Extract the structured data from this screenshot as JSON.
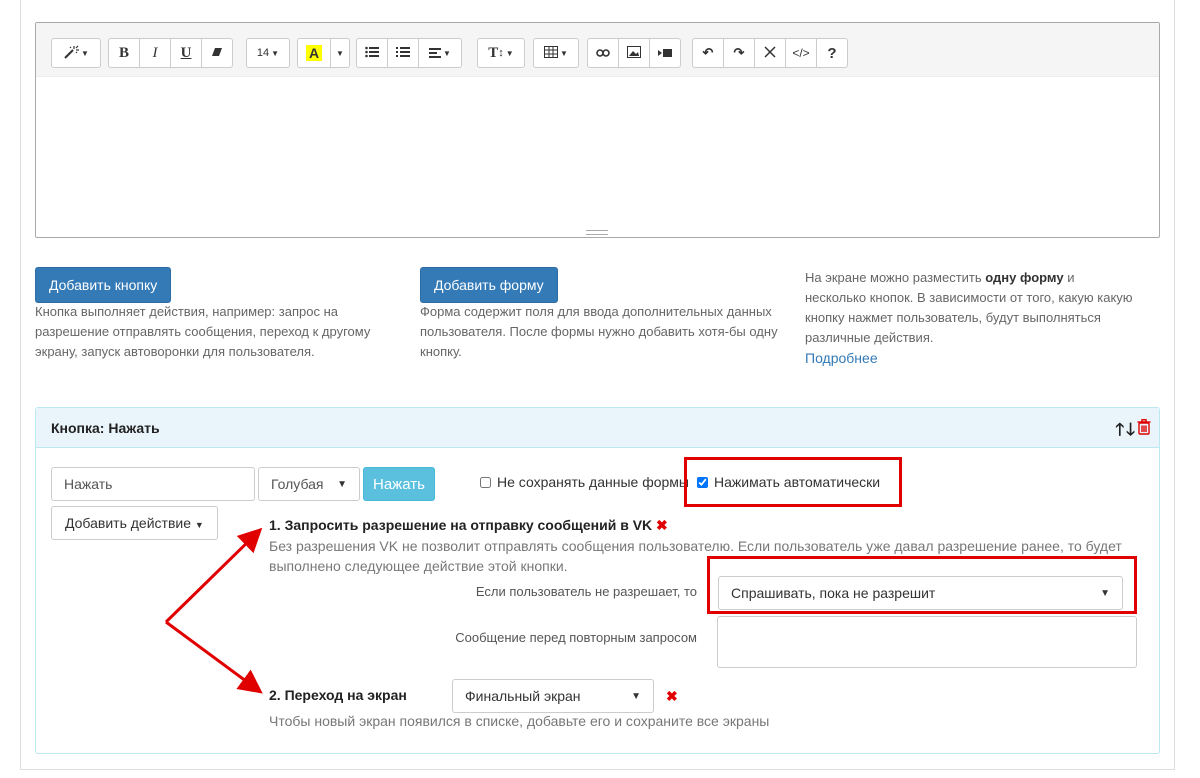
{
  "toolbar": {
    "style_icon": "magic-wand-icon",
    "bold": "B",
    "italic": "I",
    "underline": "U",
    "font_size": "14",
    "font_color": "A",
    "font_color_hex": "#ffff00",
    "help": "?",
    "code": "</>",
    "text_style": "T"
  },
  "actions": {
    "add_button_label": "Добавить кнопку",
    "add_button_desc": "Кнопка выполняет действия, например: запрос на разрешение отправлять сообщения, переход к другому экрану, запуск автоворонки для пользователя.",
    "add_form_label": "Добавить форму",
    "add_form_desc": "Форма содержит поля для ввода дополнительных данных пользователя. После формы нужно добавить хотя-бы одну кнопку.",
    "info_part1": "На экране можно разместить ",
    "info_bold": "одну форму",
    "info_part2": " и несколько кнопок. В зависимости от того, какую какую кнопку нажмет пользователь, будут выполняться различные действия.",
    "info_link": "Подробнее"
  },
  "panel": {
    "title": "Кнопка: Нажать",
    "button_text_value": "Нажать",
    "color_select": "Голубая",
    "preview_button": "Нажать",
    "no_save_label": "Не сохранять данные формы",
    "no_save_checked": false,
    "auto_press_label": "Нажимать автоматически",
    "auto_press_checked": true,
    "add_action_label": "Добавить действие",
    "step1_title": "1. Запросить разрешение на отправку сообщений в VK",
    "step1_desc": "Без разрешения VK не позволит отправлять сообщения пользователю. Если пользователь уже давал разрешение ранее, то будет выполнено следующее действие этой кнопки.",
    "if_denied_label": "Если пользователь не разрешает, то",
    "if_denied_value": "Спрашивать, пока не разрешит",
    "retry_message_label": "Сообщение перед повторным запросом",
    "retry_message_value": "",
    "step2_title": "2. Переход на экран",
    "step2_screen": "Финальный экран",
    "step2_hint": "Чтобы новый экран появился в списке, добавьте его и сохраните все экраны"
  },
  "colors": {
    "primary": "#337ab7",
    "info": "#5bc0de",
    "highlight": "#e00000"
  }
}
